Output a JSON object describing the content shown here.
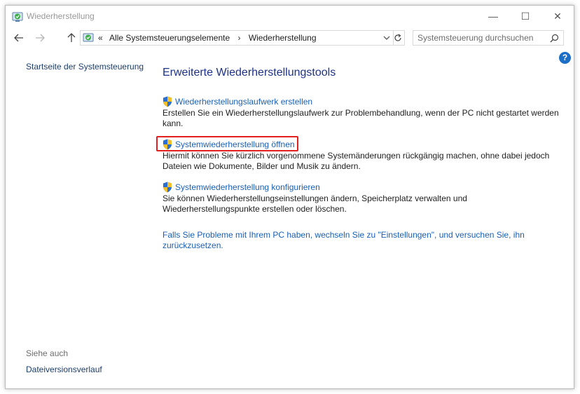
{
  "window": {
    "title": "Wiederherstellung",
    "controls": {
      "minimize": "—",
      "maximize": "☐",
      "close": "✕"
    }
  },
  "navigation": {
    "breadcrumb_prefix": "«",
    "crumbs": [
      "Alle Systemsteuerungselemente",
      "Wiederherstellung"
    ],
    "crumb_separator": "›"
  },
  "search": {
    "placeholder": "Systemsteuerung durchsuchen"
  },
  "help": {
    "label": "?"
  },
  "sidebar": {
    "home_link": "Startseite der Systemsteuerung",
    "see_also_heading": "Siehe auch",
    "see_also_link": "Dateiversionsverlauf"
  },
  "main": {
    "title": "Erweiterte Wiederherstellungstools",
    "tools": [
      {
        "link": "Wiederherstellungslaufwerk erstellen",
        "description": "Erstellen Sie ein Wiederherstellungslaufwerk zur Problembehandlung, wenn der PC nicht gestartet werden kann."
      },
      {
        "link": "Systemwiederherstellung öffnen",
        "description": "Hiermit können Sie kürzlich vorgenommene Systemänderungen rückgängig machen, ohne dabei jedoch Dateien wie Dokumente, Bilder und Musik zu ändern."
      },
      {
        "link": "Systemwiederherstellung konfigurieren",
        "description": "Sie können Wiederherstellungseinstellungen ändern, Speicherplatz verwalten und Wiederherstellungspunkte erstellen oder löschen."
      }
    ],
    "reset_link": "Falls Sie Probleme mit Ihrem PC haben, wechseln Sie zu \"Einstellungen\", und versuchen Sie, ihn zurückzusetzen."
  },
  "colors": {
    "link": "#1a5fb4",
    "title": "#1e3287",
    "highlight": "#e41f1f"
  }
}
